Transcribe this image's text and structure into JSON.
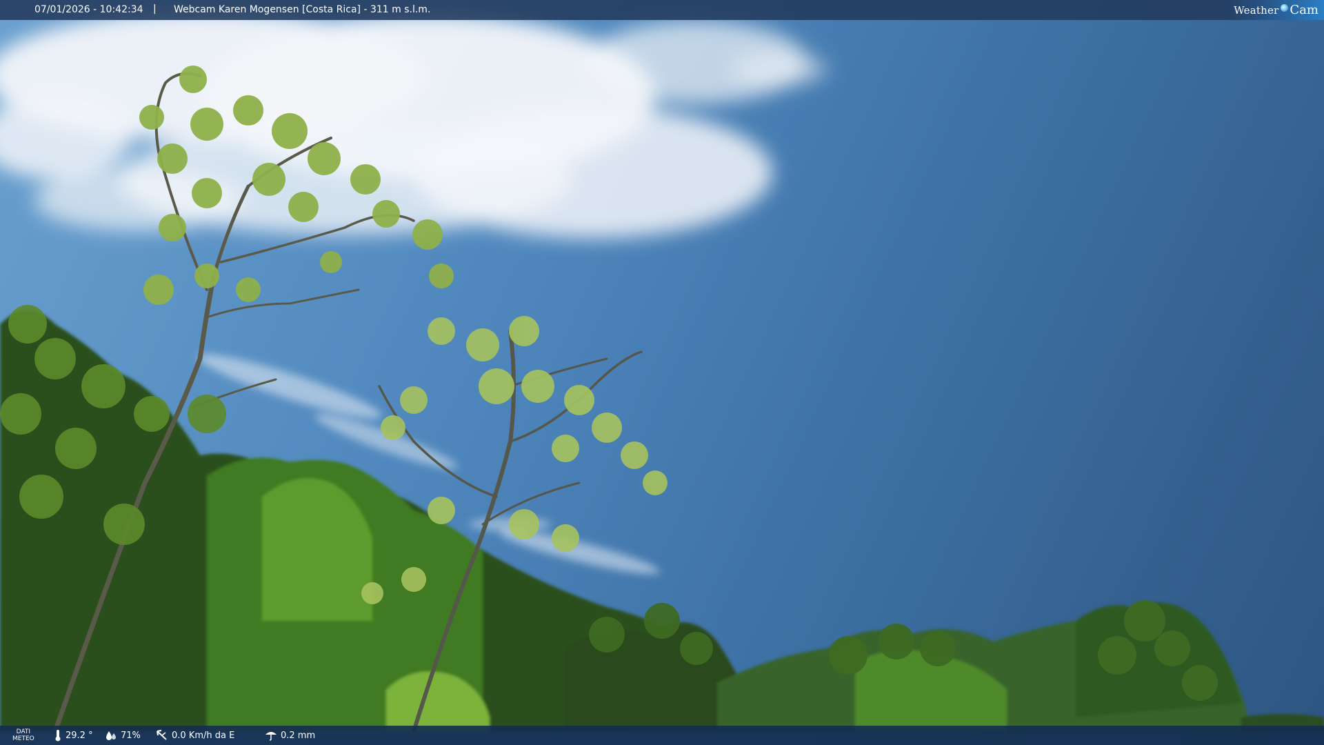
{
  "overlay_top": {
    "datetime": "07/01/2026 - 10:42:34",
    "separator": "|",
    "title": "Webcam Karen Mogensen [Costa Rica] - 311 m s.l.m."
  },
  "brand": {
    "part1": "Weather",
    "part2": "Cam",
    "lens_icon": "camera-lens-icon"
  },
  "weather": {
    "label_line1": "DATI",
    "label_line2": "METEO",
    "temperature": "29.2 °",
    "humidity": "71%",
    "wind": "0.0 Km/h da E",
    "rain": "0.2 mm",
    "icons": [
      "thermometer-icon",
      "humidity-icon",
      "wind-icon",
      "rain-icon"
    ]
  },
  "colors": {
    "sky_top": "#6aa0cf",
    "sky_deep": "#2e5682",
    "overlay_bar": "#223a5c",
    "brand_accent": "#2a7fc4",
    "foliage": "#2f5a1c"
  }
}
